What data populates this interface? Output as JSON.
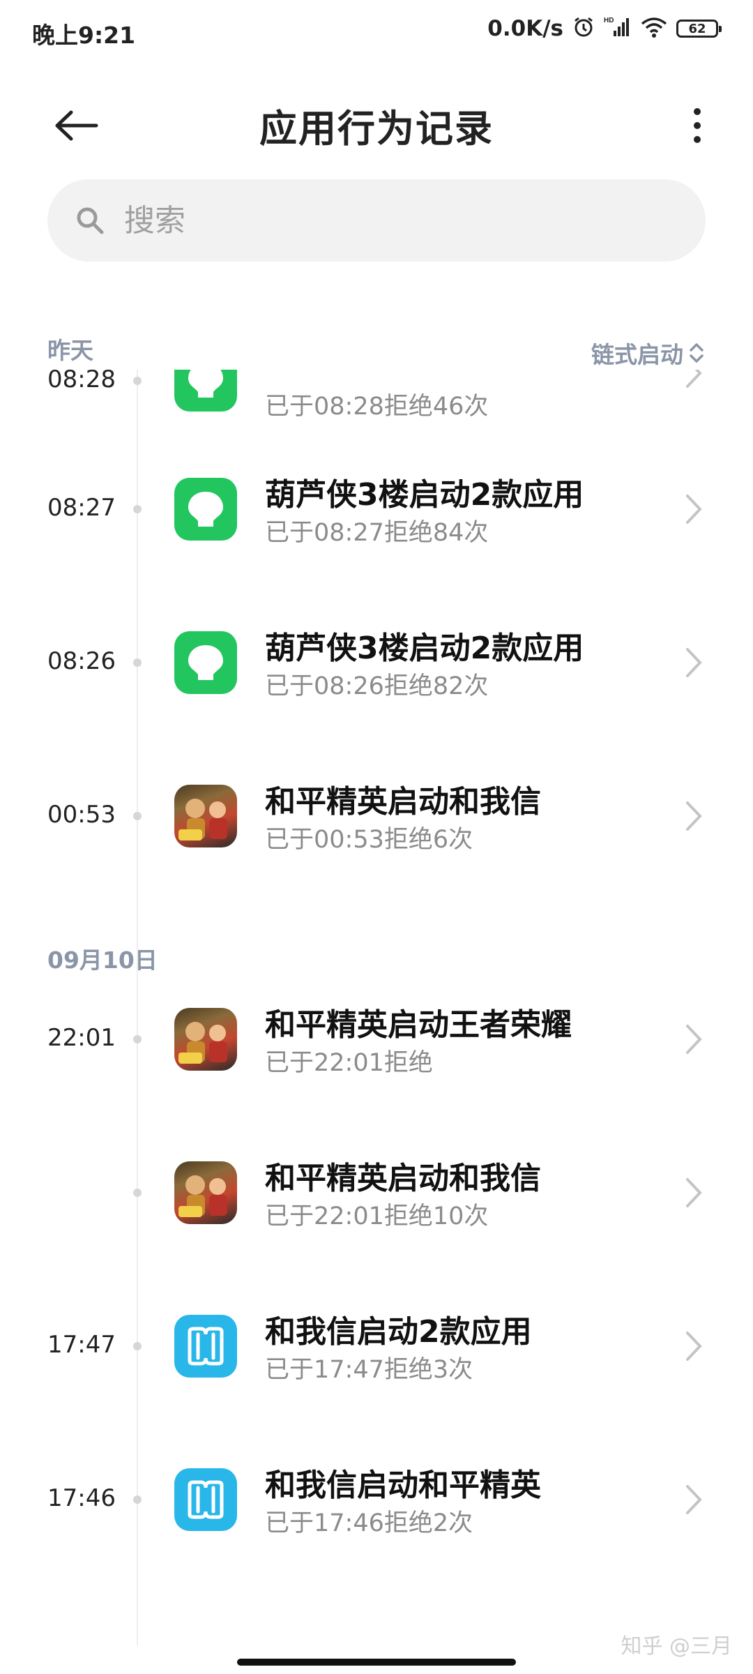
{
  "status_bar": {
    "time": "晚上9:21",
    "net_speed": "0.0K/s",
    "battery": "62",
    "signal_label": "HD"
  },
  "header": {
    "title": "应用行为记录"
  },
  "search": {
    "placeholder": "搜索"
  },
  "sections": {
    "yesterday": "昨天",
    "sep10": "09月10日",
    "sort_label": "链式启动"
  },
  "rows": [
    {
      "time": "08:28",
      "title": "",
      "subtitle": "已于08:28拒绝46次",
      "icon": "huluxia-icon"
    },
    {
      "time": "08:27",
      "title": "葫芦侠3楼启动2款应用",
      "subtitle": "已于08:27拒绝84次",
      "icon": "huluxia-icon"
    },
    {
      "time": "08:26",
      "title": "葫芦侠3楼启动2款应用",
      "subtitle": "已于08:26拒绝82次",
      "icon": "huluxia-icon"
    },
    {
      "time": "00:53",
      "title": "和平精英启动和我信",
      "subtitle": "已于00:53拒绝6次",
      "icon": "peace-elite-icon"
    },
    {
      "time": "22:01",
      "title": "和平精英启动王者荣耀",
      "subtitle": "已于22:01拒绝",
      "icon": "peace-elite-icon"
    },
    {
      "time": "",
      "title": "和平精英启动和我信",
      "subtitle": "已于22:01拒绝10次",
      "icon": "peace-elite-icon"
    },
    {
      "time": "17:47",
      "title": "和我信启动2款应用",
      "subtitle": "已于17:47拒绝3次",
      "icon": "hewoxin-icon"
    },
    {
      "time": "17:46",
      "title": "和我信启动和平精英",
      "subtitle": "已于17:46拒绝2次",
      "icon": "hewoxin-icon"
    }
  ],
  "watermark": "知乎 @三月",
  "colors": {
    "accent_label": "#8a95a8",
    "huluxia_green": "#22c55e",
    "hewoxin_blue": "#29b6e8",
    "subtext": "#8b8b8b"
  }
}
